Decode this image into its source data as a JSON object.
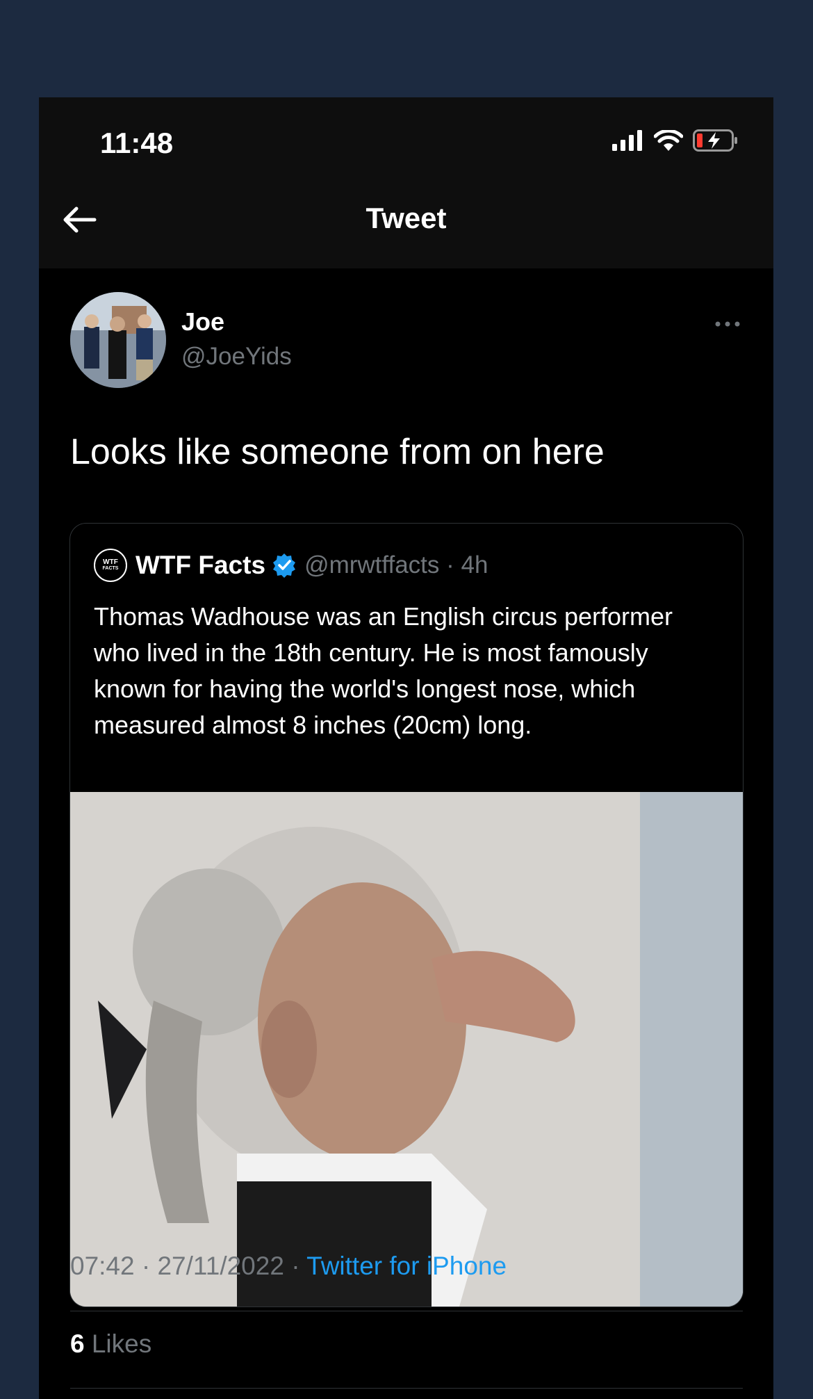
{
  "status_bar": {
    "time": "11:48",
    "icons": [
      "signal-icon",
      "wifi-icon",
      "battery-charging-icon"
    ]
  },
  "header": {
    "title": "Tweet",
    "back_icon": "arrow-left-icon"
  },
  "tweet": {
    "author_name": "Joe",
    "author_handle": "@JoeYids",
    "text": "Looks like someone from on here",
    "more_icon": "more-horizontal-icon",
    "time": "07:42",
    "date": "27/11/2022",
    "source": "Twitter for iPhone",
    "likes_count": "6",
    "likes_label": "Likes"
  },
  "quoted": {
    "logo_text_top": "WTF",
    "logo_text_bottom": "FACTS",
    "name": "WTF Facts",
    "verified_icon": "verified-badge-icon",
    "handle": "@mrwtffacts",
    "age": "4h",
    "text": "Thomas Wadhouse was an English circus performer who lived in the 18th century. He is most famously known for having the world's longest nose, which measured almost 8 inches (20cm) long."
  },
  "colors": {
    "background": "#1c2a40",
    "accent": "#1d9bf0",
    "secondary_text": "#71767b"
  }
}
